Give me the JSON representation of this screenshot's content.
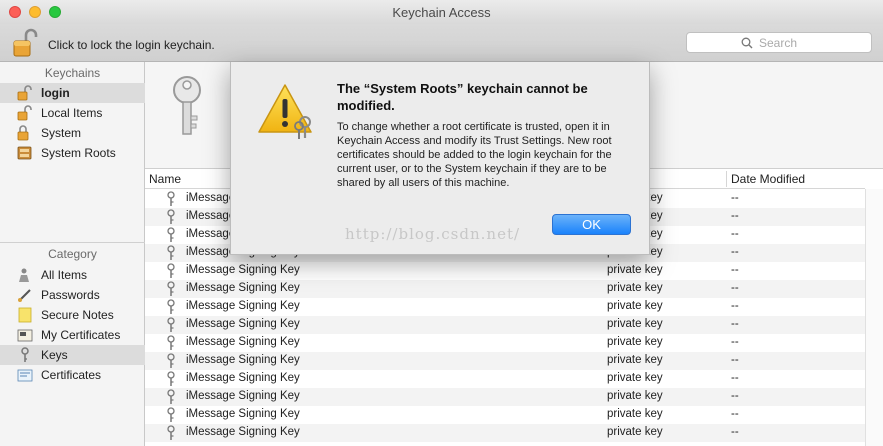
{
  "window": {
    "title": "Keychain Access"
  },
  "toolbar": {
    "lock_text": "Click to lock the login keychain.",
    "search_placeholder": "Search"
  },
  "sidebar": {
    "keychains_header": "Keychains",
    "keychains": [
      {
        "label": "login",
        "selected": true
      },
      {
        "label": "Local Items",
        "selected": false
      },
      {
        "label": "System",
        "selected": false
      },
      {
        "label": "System Roots",
        "selected": false
      }
    ],
    "category_header": "Category",
    "categories": [
      {
        "label": "All Items",
        "selected": false
      },
      {
        "label": "Passwords",
        "selected": false
      },
      {
        "label": "Secure Notes",
        "selected": false
      },
      {
        "label": "My Certificates",
        "selected": false
      },
      {
        "label": "Keys",
        "selected": true
      },
      {
        "label": "Certificates",
        "selected": false
      }
    ]
  },
  "table": {
    "columns": {
      "name": "Name",
      "date_modified": "Date Modified"
    },
    "rows": [
      {
        "name": "iMessage Signing Key",
        "kind": "private key",
        "date": "--"
      },
      {
        "name": "iMessage Signing Key",
        "kind": "private key",
        "date": "--"
      },
      {
        "name": "iMessage Signing Key",
        "kind": "private key",
        "date": "--"
      },
      {
        "name": "iMessage Signing Key",
        "kind": "private key",
        "date": "--"
      },
      {
        "name": "iMessage Signing Key",
        "kind": "private key",
        "date": "--"
      },
      {
        "name": "iMessage Signing Key",
        "kind": "private key",
        "date": "--"
      },
      {
        "name": "iMessage Signing Key",
        "kind": "private key",
        "date": "--"
      },
      {
        "name": "iMessage Signing Key",
        "kind": "private key",
        "date": "--"
      },
      {
        "name": "iMessage Signing Key",
        "kind": "private key",
        "date": "--"
      },
      {
        "name": "iMessage Signing Key",
        "kind": "private key",
        "date": "--"
      },
      {
        "name": "iMessage Signing Key",
        "kind": "private key",
        "date": "--"
      },
      {
        "name": "iMessage Signing Key",
        "kind": "private key",
        "date": "--"
      },
      {
        "name": "iMessage Signing Key",
        "kind": "private key",
        "date": "--"
      },
      {
        "name": "iMessage Signing Key",
        "kind": "private key",
        "date": "--"
      }
    ]
  },
  "dialog": {
    "title": "The “System Roots” keychain cannot be modified.",
    "body": "To change whether a root certificate is trusted, open it in Keychain Access and modify its Trust Settings. New root certificates should be added to the login keychain for the current user, or to the System keychain if they are to be shared by all users of this machine.",
    "ok_label": "OK"
  },
  "watermark": "http://blog.csdn.net/",
  "colors": {
    "accent": "#1a82fb",
    "selection": "#dcdcdc"
  }
}
